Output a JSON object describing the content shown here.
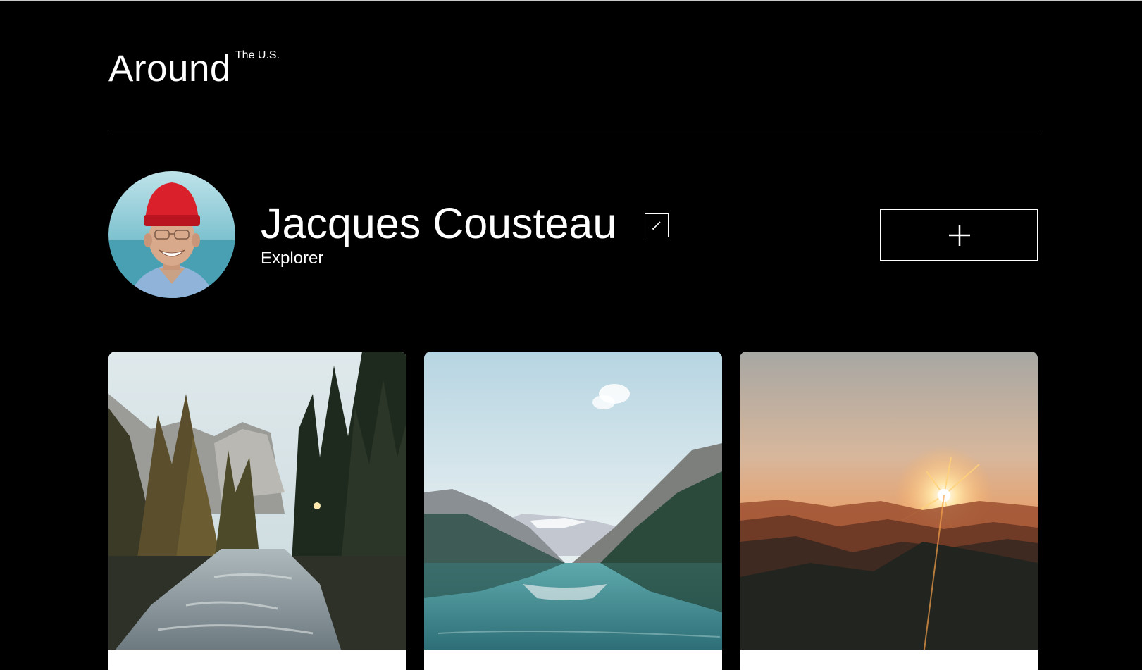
{
  "header": {
    "logo_main": "Around",
    "logo_sup": "The U.S."
  },
  "profile": {
    "name": "Jacques Cousteau",
    "job": "Explorer",
    "edit_icon": "pencil-icon",
    "add_icon": "plus-icon"
  },
  "cards": [
    {
      "image": "forest-river-valley"
    },
    {
      "image": "mountain-lake-reflection"
    },
    {
      "image": "mountain-sunset"
    }
  ],
  "colors": {
    "background": "#000000",
    "text": "#ffffff",
    "divider": "#545454",
    "card_background": "#ffffff",
    "hat": "#d9202b"
  }
}
